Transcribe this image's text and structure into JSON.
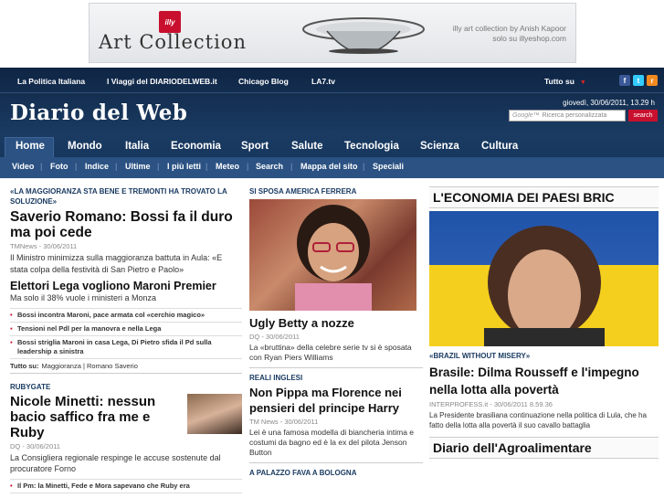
{
  "banner": {
    "brand": "illy",
    "title": "Art Collection",
    "credit_line1": "illy art collection by Anish Kapoor",
    "credit_line2": "solo su illyeshop.com"
  },
  "topnav": {
    "links": [
      "La Politica Italiana",
      "I Viaggi del DIARIODELWEB.it",
      "Chicago Blog",
      "LA7.tv"
    ],
    "tutto_su": "Tutto su",
    "social_icons": [
      "facebook-icon",
      "twitter-icon",
      "rss-icon"
    ]
  },
  "site": {
    "logo": "Diario del Web",
    "datetime": "giovedì,  30/06/2011, 13.29 h",
    "search_placeholder": "Ricerca personalizzata",
    "search_brand": "Google™",
    "search_button": "search"
  },
  "mainnav": [
    "Home",
    "Mondo",
    "Italia",
    "Economia",
    "Sport",
    "Salute",
    "Tecnologia",
    "Scienza",
    "Cultura"
  ],
  "subnav": [
    "Video",
    "Foto",
    "Indice",
    "Ultime",
    "I più letti",
    "Meteo",
    "Search",
    "Mappa del sito",
    "Speciali"
  ],
  "col1": {
    "kicker1": "«LA MAGGIORANZA STA BENE E TREMONTI HA TROVATO LA SOLUZIONE»",
    "headline1": "Saverio Romano: Bossi fa il duro ma poi cede",
    "meta1": "TMNews - 30/06/2011",
    "body1": "Il Ministro minimizza sulla maggioranza battuta in Aula: «E stata colpa della festività di San Pietro e Paolo»",
    "subhead": "Elettori Lega vogliono Maroni Premier",
    "subbody": "Ma solo il 38% vuole i ministeri a Monza",
    "related": [
      "Bossi incontra Maroni, pace armata col «cerchio magico»",
      "Tensioni nel Pdl per la manovra e nella Lega",
      "Bossi striglia Maroni in casa Lega, Di Pietro sfida il Pd sulla leadership a sinistra"
    ],
    "tutto_su_label": "Tutto su:",
    "tutto_su_value": "Maggioranza | Romano Saverio",
    "kicker2": "RUBYGATE",
    "headline2": "Nicole Minetti: nessun bacio saffico fra me e Ruby",
    "meta2": "DQ - 30/06/2011",
    "body2": "La Consigliera regionale respinge le accuse sostenute dal procuratore Forno",
    "related2": "Il Pm: la Minetti, Fede e Mora sapevano che Ruby era"
  },
  "col2": {
    "kicker1": "SI SPOSA AMERICA FERRERA",
    "headline1": "Ugly Betty a nozze",
    "meta1": "DQ - 30/06/2011",
    "body1": "La «bruttina» della celebre serie tv si è sposata con Ryan Piers Williams",
    "kicker2": "REALI INGLESI",
    "headline2": "Non Pippa ma Florence nei pensieri del principe Harry",
    "meta2": "TM News - 30/06/2011",
    "body2": "Lei è una famosa modella di biancheria intima e costumi da bagno ed è la ex del pilota Jenson Button",
    "kicker3": "A PALAZZO FAVA A BOLOGNA"
  },
  "col3": {
    "section1": "L'ECONOMIA DEI PAESI BRIC",
    "kicker": "«BRAZIL WITHOUT MISERY»",
    "headline": "Brasile: Dilma Rousseff e l'impegno nella lotta alla povertà",
    "meta": "INTERPROFESS.it - 30/06/2011 8.59.36",
    "body": "La Presidente brasiliana continuazione nella politica di Lula, che ha fatto della lotta alla povertà il suo cavallo battaglia",
    "section2": "Diario dell'Agroalimentare"
  }
}
